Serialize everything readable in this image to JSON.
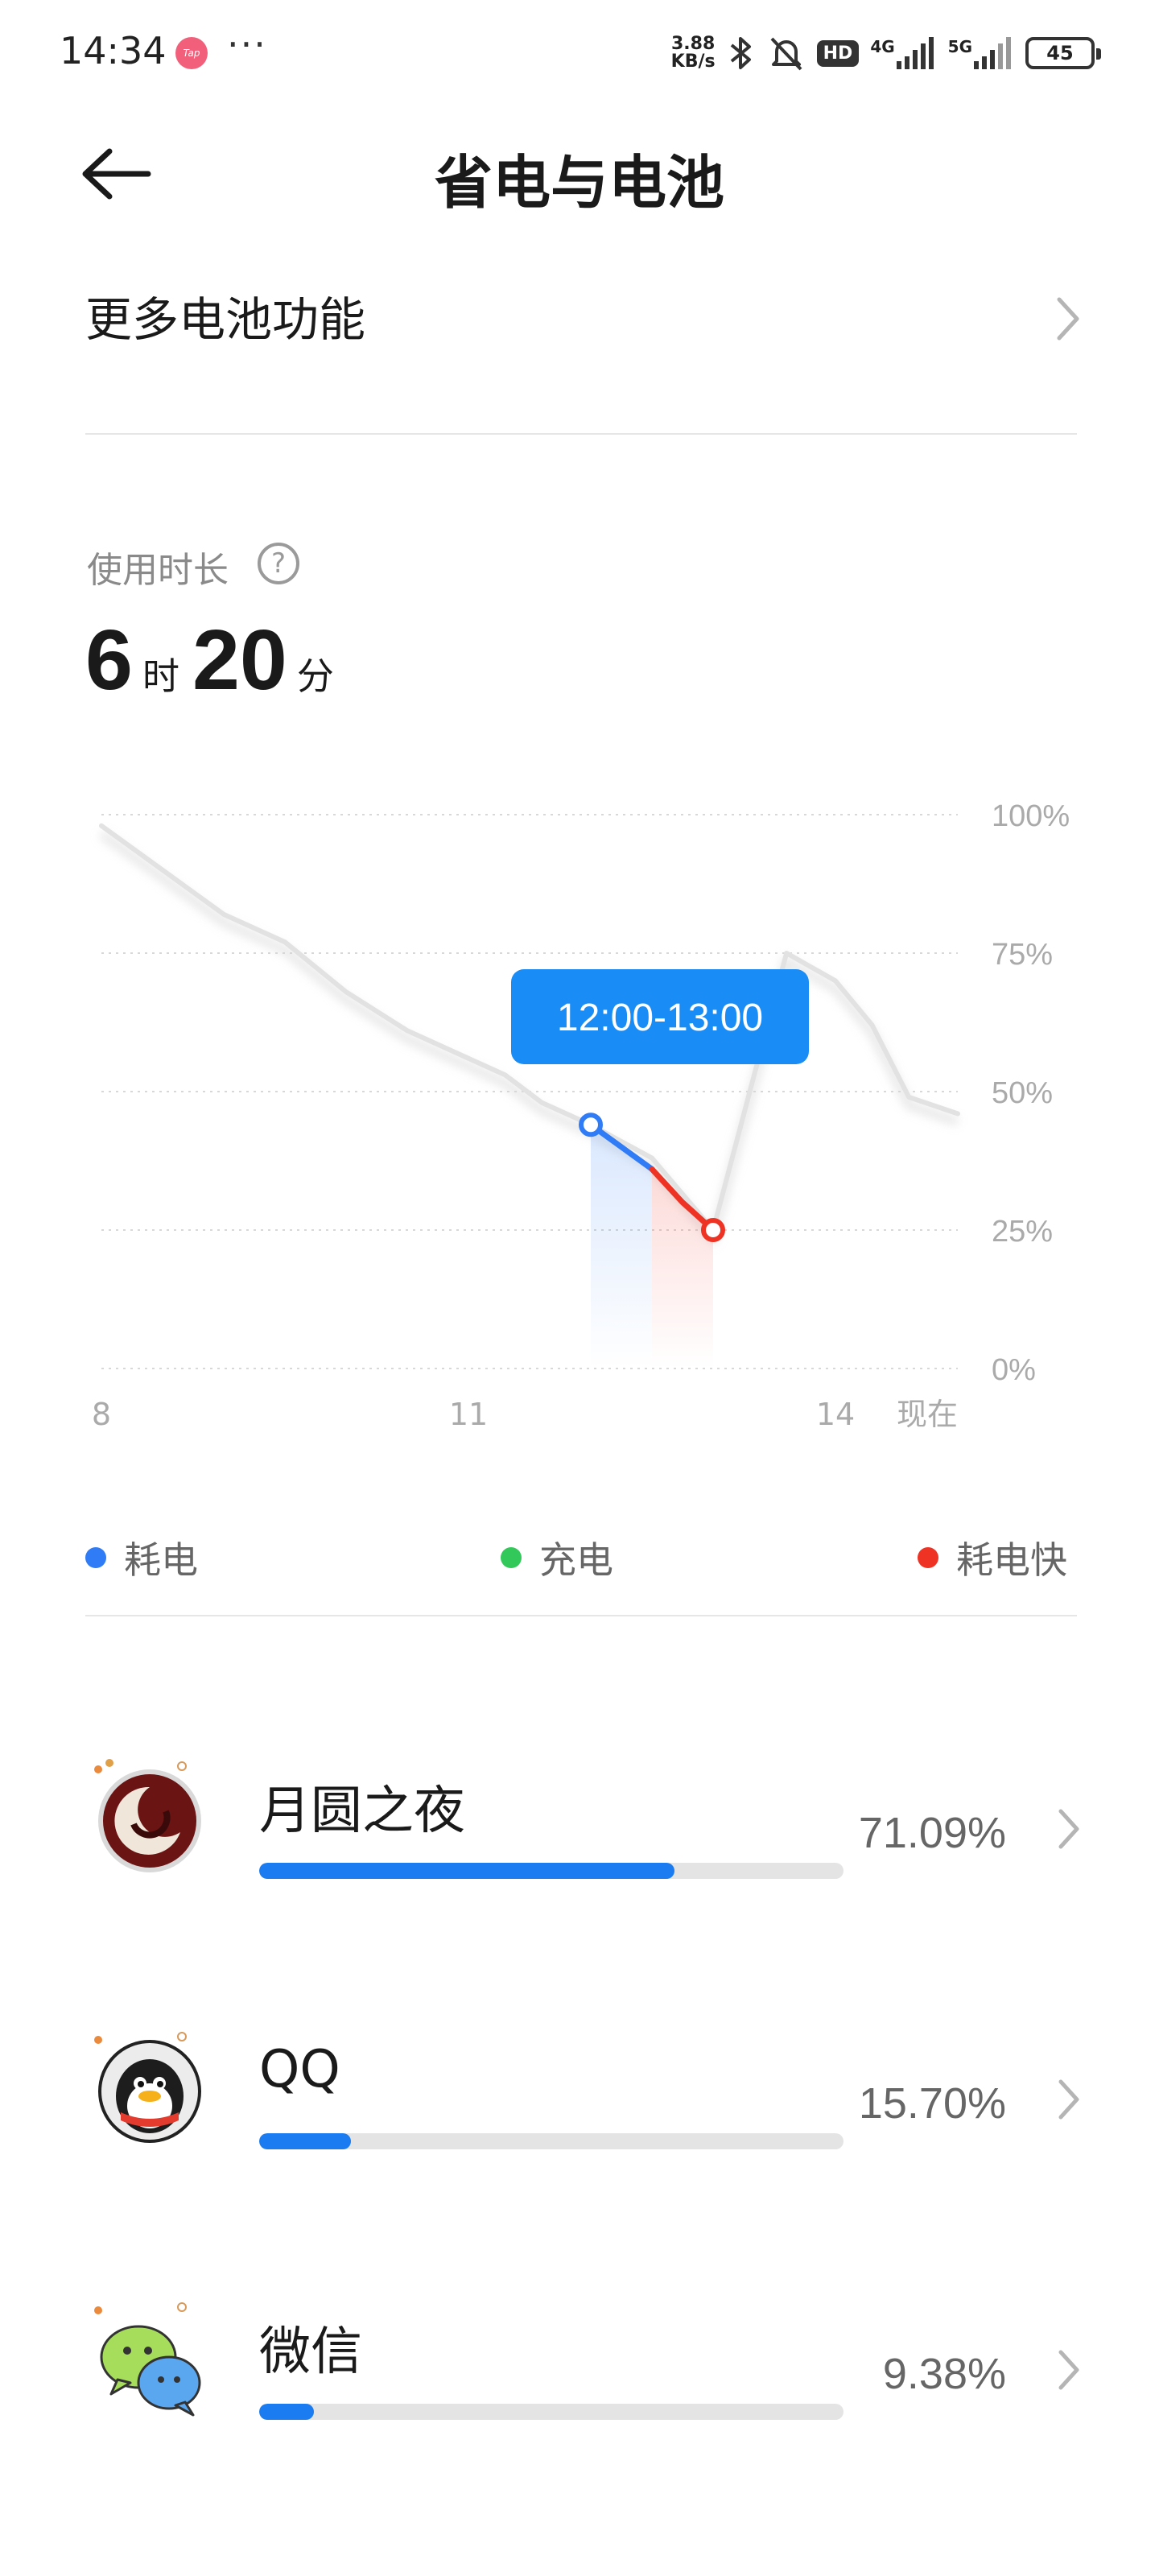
{
  "status_bar": {
    "time": "14:34",
    "tap_badge": "Tap",
    "more": "···",
    "speed_value": "3.88",
    "speed_unit": "KB/s",
    "hd": "HD",
    "net1": "4G",
    "net2": "5G",
    "battery": "45"
  },
  "header": {
    "title": "省电与电池"
  },
  "more_battery": {
    "label": "更多电池功能"
  },
  "usage": {
    "label": "使用时长",
    "hours": "6",
    "hours_unit": "时",
    "minutes": "20",
    "minutes_unit": "分"
  },
  "chart_data": {
    "type": "line",
    "y_ticks": [
      "100%",
      "75%",
      "50%",
      "25%",
      "0%"
    ],
    "x_ticks": [
      "8",
      "11",
      "14",
      "现在"
    ],
    "ylim": [
      0,
      100
    ],
    "grid": true,
    "tooltip": "12:00-13:00",
    "series": [
      {
        "x": [
          8.0,
          8.5,
          9.0,
          9.5,
          10.0,
          10.5,
          11.0,
          11.3,
          11.6,
          12.0,
          12.5,
          13.0,
          13.3,
          13.6,
          14.0,
          14.3,
          14.6,
          15.0
        ],
        "values": [
          98,
          90,
          82,
          77,
          68,
          61,
          56,
          53,
          48,
          44,
          38,
          25,
          50,
          75,
          70,
          62,
          49,
          46
        ]
      }
    ],
    "highlight": [
      {
        "kind": "normal",
        "x": [
          12.0,
          12.25,
          12.5
        ],
        "values": [
          44,
          40,
          36
        ]
      },
      {
        "kind": "fast",
        "x": [
          12.5,
          12.75,
          13.0
        ],
        "values": [
          36,
          30,
          25
        ]
      }
    ]
  },
  "legend": [
    {
      "label": "耗电",
      "color": "#2f7cf6"
    },
    {
      "label": "充电",
      "color": "#33c95a"
    },
    {
      "label": "耗电快",
      "color": "#ee3325"
    }
  ],
  "apps": [
    {
      "name": "月圆之夜",
      "percent_text": "71.09%",
      "percent": 71.09,
      "icon": "moon-night-game-icon"
    },
    {
      "name": "QQ",
      "percent_text": "15.70%",
      "percent": 15.7,
      "icon": "qq-penguin-icon"
    },
    {
      "name": "微信",
      "percent_text": "9.38%",
      "percent": 9.38,
      "icon": "wechat-icon"
    }
  ]
}
